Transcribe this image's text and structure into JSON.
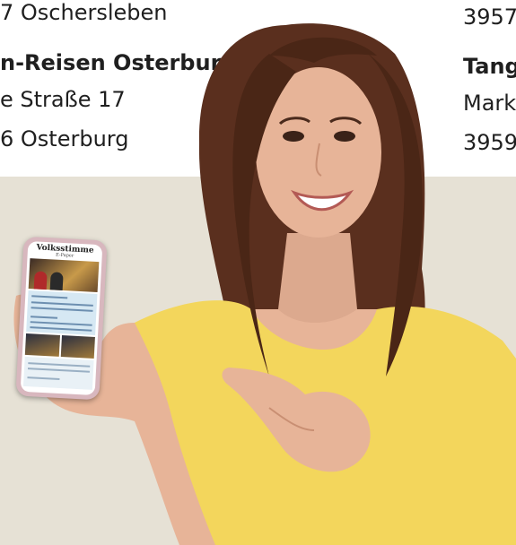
{
  "addresses": {
    "left": {
      "line1": "7 Oschersleben",
      "line2": "n-Reisen Osterburg",
      "line3": "e Straße 17",
      "line4": "6 Osterburg"
    },
    "right": {
      "line1": "3957",
      "line2": "Tang",
      "line3": "Mark",
      "line4": "3959"
    }
  },
  "phone": {
    "masthead": "Volksstimme",
    "subtitle": "E-Paper"
  },
  "colors": {
    "beige_panel": "#e6e1d5",
    "shirt": "#f3d65c",
    "hair": "#5a2f1e",
    "skin": "#e7b498",
    "phone_case": "#d8b7be"
  }
}
